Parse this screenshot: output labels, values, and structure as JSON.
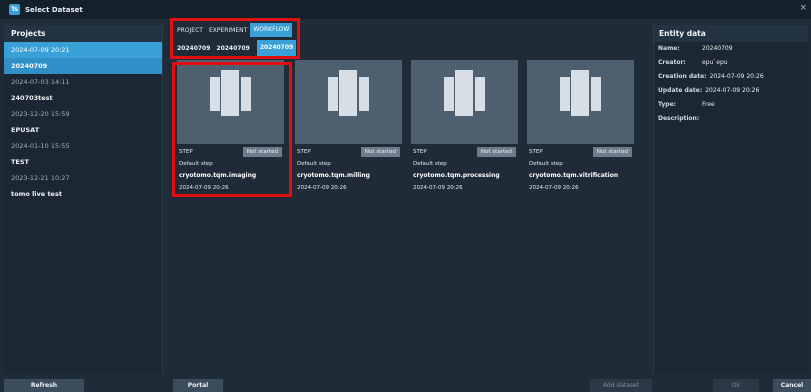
{
  "window": {
    "title": "Select Dataset",
    "app_badge": "Ts",
    "close": "×"
  },
  "projects": {
    "header": "Projects",
    "items": [
      {
        "label": "2024-07-09 20:21",
        "kind": "sel"
      },
      {
        "label": "20240709",
        "kind": "sel2"
      },
      {
        "label": "2024-07-03 14:11",
        "kind": "date"
      },
      {
        "label": "240703test",
        "kind": "bold"
      },
      {
        "label": "2023-12-20 15:59",
        "kind": "date"
      },
      {
        "label": "EPUSAT",
        "kind": "bold"
      },
      {
        "label": "2024-01-10 15:55",
        "kind": "date"
      },
      {
        "label": "TEST",
        "kind": "bold"
      },
      {
        "label": "2023-12-21 10:27",
        "kind": "date"
      },
      {
        "label": "tomo live test",
        "kind": "bold"
      }
    ]
  },
  "breadcrumb": {
    "project_label": "PROJECT",
    "experiment_label": "EXPERIMENT",
    "workflow_label": "WORKFLOW",
    "project_value": "20240709",
    "experiment_value": "20240709",
    "workflow_value": "20240709"
  },
  "cards": [
    {
      "step": "STEP",
      "status": "Not started",
      "desc": "Default step",
      "name": "cryotomo.tqm.imaging",
      "date": "2024-07-09 20:26"
    },
    {
      "step": "STEP",
      "status": "Not started",
      "desc": "Default step",
      "name": "cryotomo.tqm.milling",
      "date": "2024-07-09 20:26"
    },
    {
      "step": "STEP",
      "status": "Not started",
      "desc": "Default step",
      "name": "cryotomo.tqm.processing",
      "date": "2024-07-09 20:26"
    },
    {
      "step": "STEP",
      "status": "Not started",
      "desc": "Default step",
      "name": "cryotomo.tqm.vitrification",
      "date": "2024-07-09 20:26"
    }
  ],
  "entity": {
    "header": "Entity data",
    "name_key": "Name:",
    "name_val": "20240709",
    "creator_key": "Creator:",
    "creator_val": "epu`epu",
    "created_key": "Creation date:",
    "created_val": "2024-07-09 20:26",
    "updated_key": "Update date:",
    "updated_val": "2024-07-09 20:26",
    "type_key": "Type:",
    "type_val": "Free",
    "desc_key": "Description:"
  },
  "buttons": {
    "refresh": "Refresh",
    "portal": "Portal",
    "add_dataset": "Add dataset",
    "ok": "Ok",
    "cancel": "Cancel"
  }
}
